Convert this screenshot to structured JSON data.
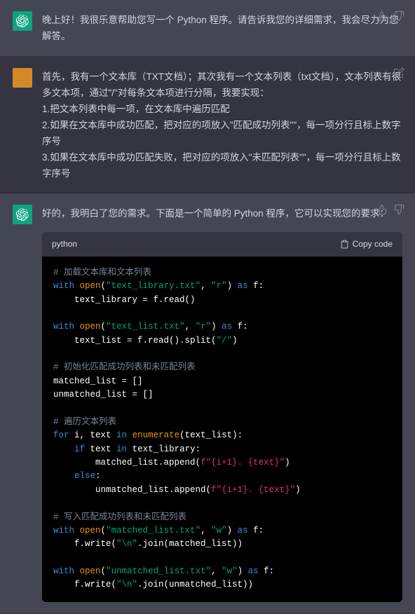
{
  "messages": {
    "m1": {
      "text": "晚上好！我很乐意帮助您写一个 Python 程序。请告诉我您的详细需求，我会尽力为您解答。"
    },
    "m2": {
      "line1": "首先，我有一个文本库（TXT文档）；其次我有一个文本列表（txt文档），文本列表有很多文本项，通过\"/\"对每条文本项进行分隔，我要实现：",
      "line2": "1.把文本列表中每一项，在文本库中遍历匹配",
      "line3": "2.如果在文本库中成功匹配，把对应的项放入\"匹配成功列表\"\"，每一项分行且标上数字序号",
      "line4": "3.如果在文本库中成功匹配失败，把对应的项放入\"未匹配列表\"\"，每一项分行且标上数字序号"
    },
    "m3": {
      "intro": "好的，我明白了您的需求。下面是一个简单的 Python 程序，它可以实现您的要求：",
      "lang": "python",
      "copy_label": "Copy code"
    }
  },
  "code": {
    "c1": "# 加载文本库和文本列表",
    "s1a": "\"text_library.txt\"",
    "s1b": "\"r\"",
    "c2": "# 初始化匹配成功列表和未匹配列表",
    "s2a": "\"text_list.txt\"",
    "s2b": "\"r\"",
    "s2c": "\"/\"",
    "c3": "# 遍历文本列表",
    "fs1": "f\"{i+1}. {text}\"",
    "fs2": "f\"{i+1}. {text}\"",
    "c4": "# 写入匹配成功列表和未匹配列表",
    "s3a": "\"matched_list.txt\"",
    "s3b": "\"w\"",
    "s3c": "\"\\n\"",
    "s4a": "\"unmatched_list.txt\"",
    "s4b": "\"w\"",
    "s4c": "\"\\n\""
  }
}
